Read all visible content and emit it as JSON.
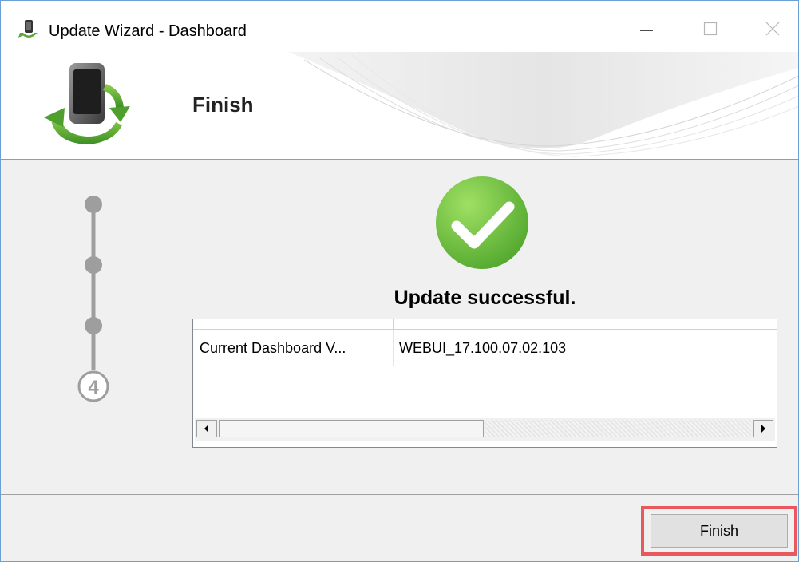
{
  "window": {
    "title": "Update Wizard - Dashboard",
    "icons": {
      "app": "phone-download-icon",
      "minimize": "minimize-icon",
      "maximize": "maximize-icon",
      "close": "close-icon"
    }
  },
  "header": {
    "title": "Finish",
    "logo_icon": "phone-sync-icon"
  },
  "stepper": {
    "current_step_label": "4",
    "total_steps": 4,
    "current_step": 4
  },
  "result": {
    "status_icon": "checkmark-circle-icon",
    "message": "Update successful."
  },
  "details_table": {
    "columns": [
      "",
      ""
    ],
    "rows": [
      {
        "name": "Current Dashboard V...",
        "value": "WEBUI_17.100.07.02.103"
      }
    ]
  },
  "footer": {
    "finish_label": "Finish"
  },
  "colors": {
    "success_green": "#5cb83a",
    "highlight_red": "#e8595f",
    "stepper_gray": "#9e9e9e"
  }
}
